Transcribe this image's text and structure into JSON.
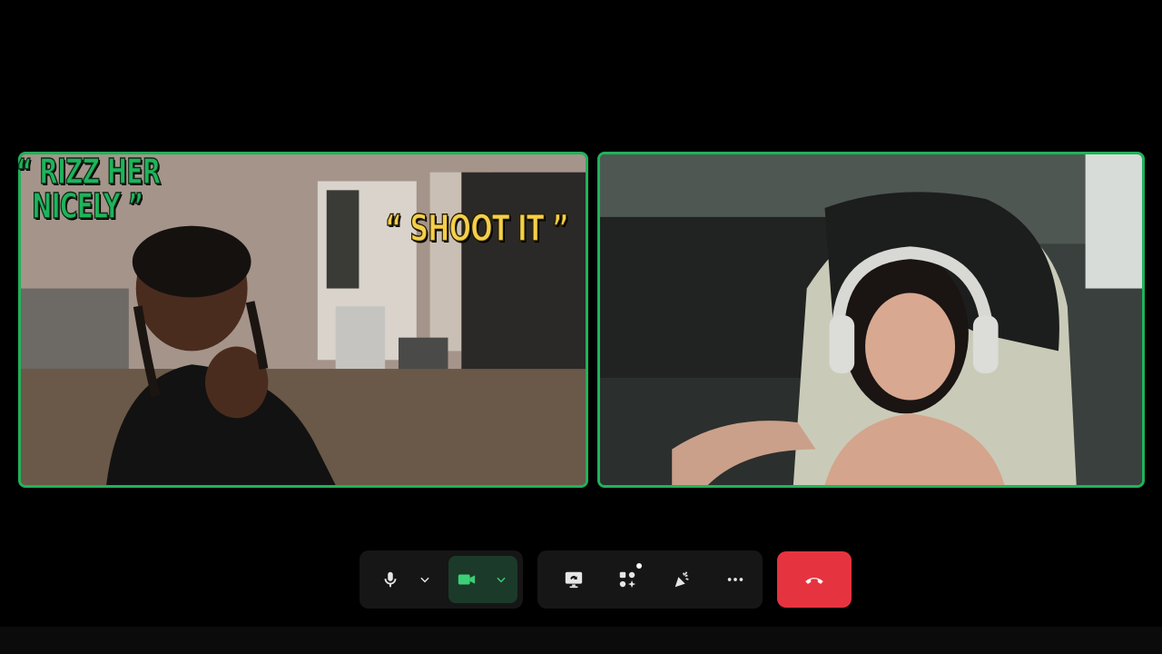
{
  "captions": {
    "left_line1": "“ RIZZ HER",
    "left_line2": "NICELY ”",
    "right": "“ SHOOT IT ”"
  },
  "colors": {
    "tile_border": "#21b25a",
    "caption_green": "#1fb45b",
    "caption_yellow": "#f4cf4b",
    "hangup": "#e5343f",
    "camera_active": "#3ccf76"
  },
  "toolbar": {
    "mic": "microphone-icon",
    "mic_options": "chevron-down-icon",
    "camera": "video-camera-icon",
    "camera_options": "chevron-down-icon",
    "share_screen": "screen-share-icon",
    "apps": "apps-grid-icon",
    "reactions": "party-popper-icon",
    "more": "more-horizontal-icon",
    "leave": "phone-hangup-icon"
  }
}
